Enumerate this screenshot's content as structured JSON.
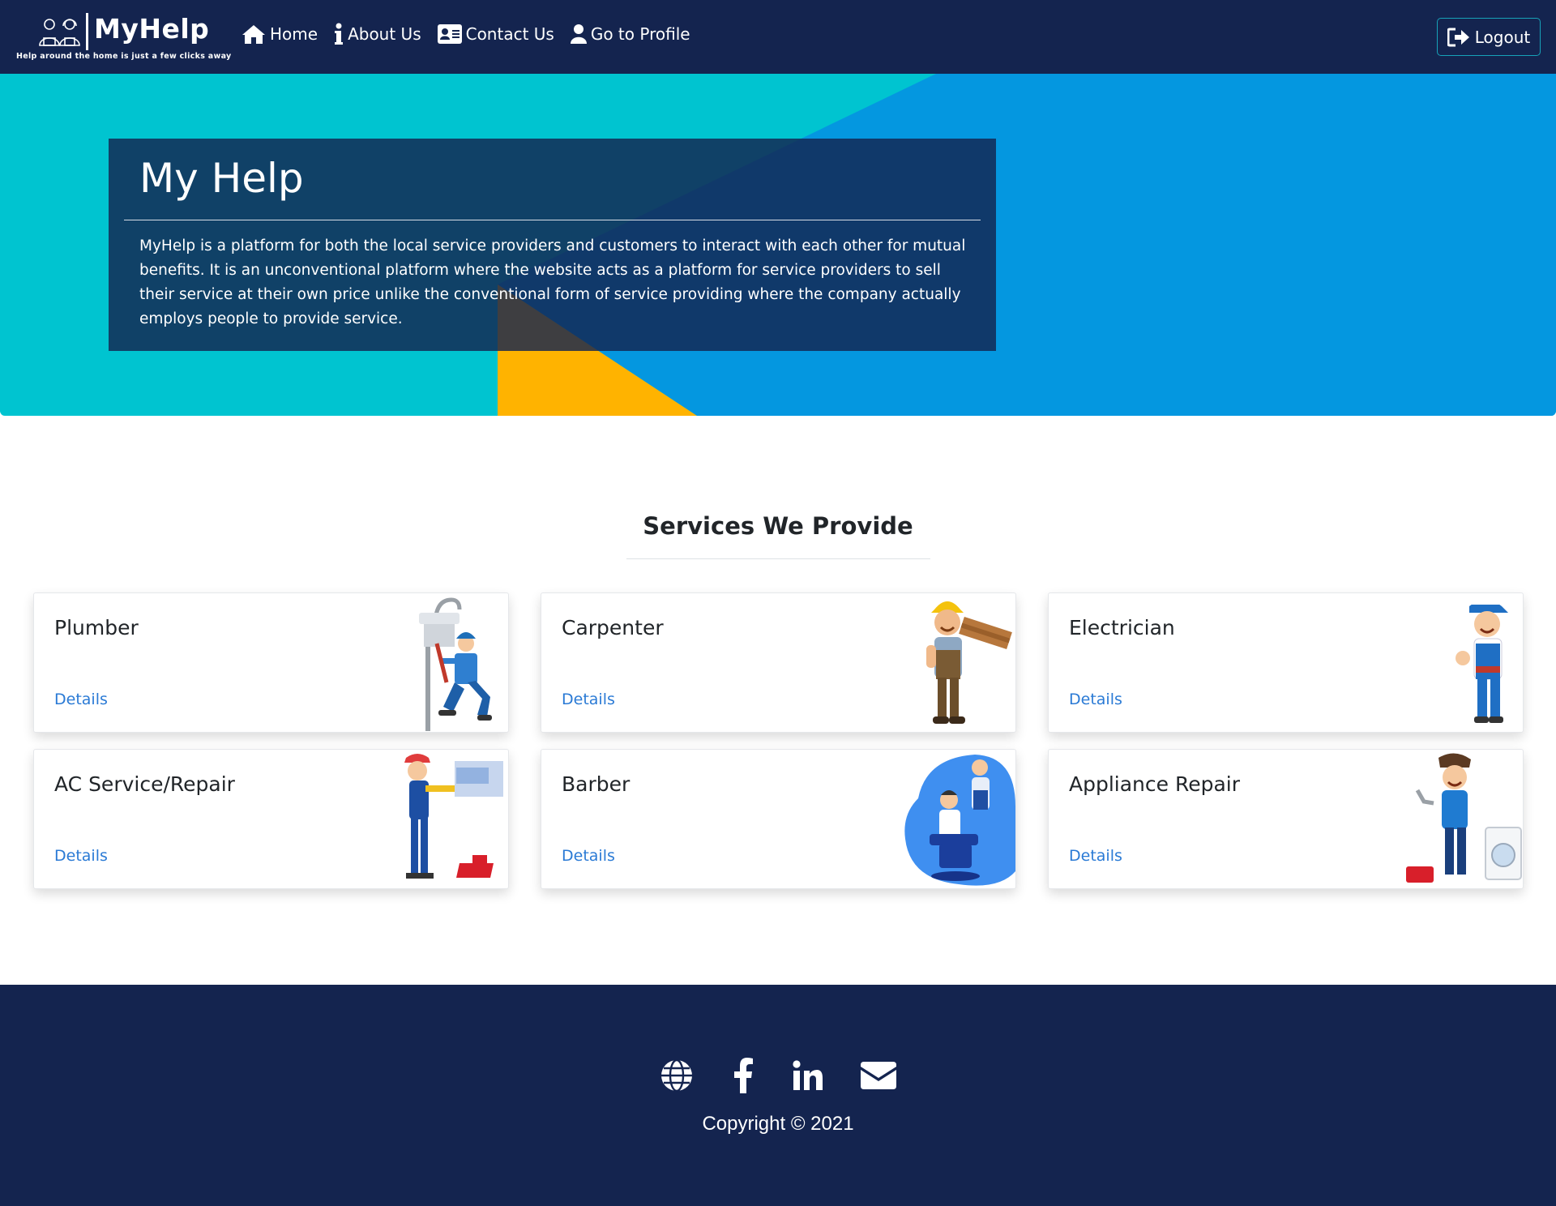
{
  "brand": {
    "name": "MyHelp",
    "tagline": "Help around the home is just a few clicks away"
  },
  "nav": {
    "items": [
      {
        "label": "Home",
        "icon": "home-icon"
      },
      {
        "label": "About Us",
        "icon": "info-icon"
      },
      {
        "label": "Contact Us",
        "icon": "address-card-icon"
      },
      {
        "label": "Go to Profile",
        "icon": "user-icon"
      }
    ],
    "logout_label": "Logout"
  },
  "hero": {
    "title": "My Help",
    "description": "MyHelp is a platform for both the local service providers and customers to interact with each other for mutual benefits. It is an unconventional platform where the website acts as a platform for service providers to sell their service at their own price unlike the conventional form of service providing where the company actually employs people to provide service."
  },
  "services": {
    "heading": "Services We Provide",
    "cards": [
      {
        "title": "Plumber",
        "link": "Details",
        "image": "plumber-illustration"
      },
      {
        "title": "Carpenter",
        "link": "Details",
        "image": "carpenter-illustration"
      },
      {
        "title": "Electrician",
        "link": "Details",
        "image": "electrician-illustration"
      },
      {
        "title": "AC Service/Repair",
        "link": "Details",
        "image": "ac-repair-illustration"
      },
      {
        "title": "Barber",
        "link": "Details",
        "image": "barber-illustration"
      },
      {
        "title": "Appliance Repair",
        "link": "Details",
        "image": "appliance-repair-illustration"
      }
    ]
  },
  "footer": {
    "social": [
      "globe-icon",
      "facebook-icon",
      "linkedin-icon",
      "envelope-icon"
    ],
    "copyright": "Copyright © 2021"
  },
  "colors": {
    "navy": "#14244f",
    "hero_teal": "#00c4d0",
    "hero_blue": "#0497e0",
    "hero_yellow": "#ffb300",
    "link_blue": "#2a7ad5",
    "logout_border": "#17a2b8"
  }
}
